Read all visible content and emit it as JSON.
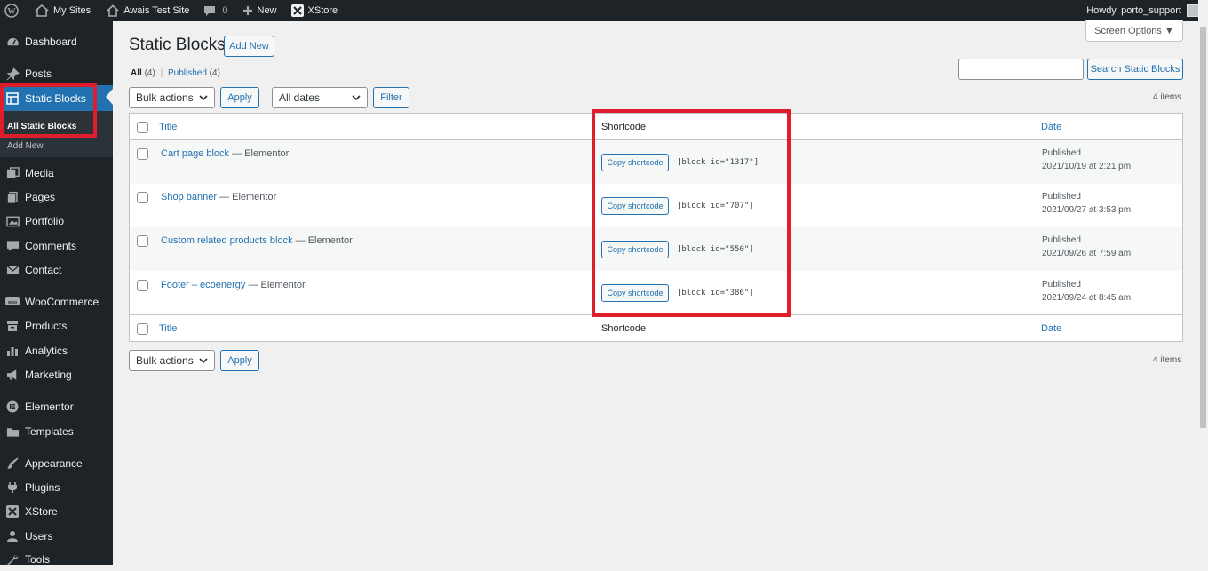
{
  "admin_bar": {
    "my_sites": "My Sites",
    "site_name": "Awais Test Site",
    "comments_count": "0",
    "new_label": "New",
    "xstore_label": "XStore",
    "howdy": "Howdy, porto_support"
  },
  "sidebar": {
    "items": [
      {
        "label": "Dashboard",
        "icon": "dashboard-icon"
      },
      {
        "label": "Posts",
        "icon": "pin-icon"
      },
      {
        "label": "Static Blocks",
        "icon": "table-icon"
      },
      {
        "label": "Media",
        "icon": "media-icon"
      },
      {
        "label": "Pages",
        "icon": "pages-icon"
      },
      {
        "label": "Portfolio",
        "icon": "portfolio-icon"
      },
      {
        "label": "Comments",
        "icon": "comment-icon"
      },
      {
        "label": "Contact",
        "icon": "envelope-icon"
      },
      {
        "label": "WooCommerce",
        "icon": "woo-icon"
      },
      {
        "label": "Products",
        "icon": "archive-icon"
      },
      {
        "label": "Analytics",
        "icon": "bar-chart-icon"
      },
      {
        "label": "Marketing",
        "icon": "megaphone-icon"
      },
      {
        "label": "Elementor",
        "icon": "elementor-icon"
      },
      {
        "label": "Templates",
        "icon": "folder-icon"
      },
      {
        "label": "Appearance",
        "icon": "brush-icon"
      },
      {
        "label": "Plugins",
        "icon": "plug-icon"
      },
      {
        "label": "XStore",
        "icon": "x-icon"
      },
      {
        "label": "Users",
        "icon": "user-icon"
      },
      {
        "label": "Tools",
        "icon": "wrench-icon"
      }
    ],
    "submenu": {
      "all_static_blocks": "All Static Blocks",
      "add_new": "Add New"
    }
  },
  "header": {
    "title": "Static Blocks",
    "add_new": "Add New",
    "screen_options": "Screen Options ▼"
  },
  "filters": {
    "all_label": "All",
    "all_count": "(4)",
    "separator": "|",
    "published_label": "Published",
    "published_count": "(4)",
    "bulk_actions": "Bulk actions",
    "apply": "Apply",
    "all_dates": "All dates",
    "filter": "Filter",
    "search_button": "Search Static Blocks",
    "search_value": "",
    "items_count": "4 items"
  },
  "table": {
    "columns": {
      "title": "Title",
      "shortcode": "Shortcode",
      "date": "Date"
    },
    "copy_label": "Copy shortcode",
    "rows": [
      {
        "title": "Cart page block",
        "suffix": " — Elementor",
        "shortcode": "[block id=\"1317\"]",
        "status": "Published",
        "date": "2021/10/19 at 2:21 pm"
      },
      {
        "title": "Shop banner",
        "suffix": " — Elementor",
        "shortcode": "[block id=\"707\"]",
        "status": "Published",
        "date": "2021/09/27 at 3:53 pm"
      },
      {
        "title": "Custom related products block",
        "suffix": " — Elementor",
        "shortcode": "[block id=\"550\"]",
        "status": "Published",
        "date": "2021/09/26 at 7:59 am"
      },
      {
        "title": "Footer – ecoenergy",
        "suffix": " — Elementor",
        "shortcode": "[block id=\"386\"]",
        "status": "Published",
        "date": "2021/09/24 at 8:45 am"
      }
    ]
  },
  "colors": {
    "admin_bg": "#1d2327",
    "accent": "#2271b1",
    "highlight": "#e01d2d"
  }
}
